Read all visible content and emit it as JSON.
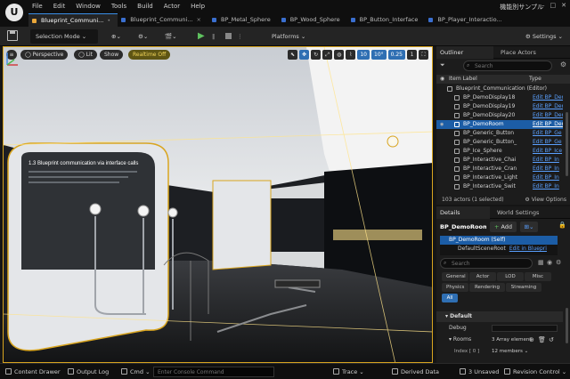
{
  "menu": [
    "File",
    "Edit",
    "Window",
    "Tools",
    "Build",
    "Actor",
    "Help"
  ],
  "project_name": "機能別サンプル",
  "tabs": [
    {
      "label": "Blueprint_Communi...",
      "active": true,
      "mark": "•"
    },
    {
      "label": "Blueprint_Communi...",
      "active": false,
      "mark": "×"
    },
    {
      "label": "BP_Metal_Sphere",
      "active": false,
      "mark": ""
    },
    {
      "label": "BP_Wood_Sphere",
      "active": false,
      "mark": ""
    },
    {
      "label": "BP_Button_Interface",
      "active": false,
      "mark": ""
    },
    {
      "label": "BP_Player_Interactio...",
      "active": false,
      "mark": ""
    }
  ],
  "toolbar": {
    "selection_mode": "Selection Mode ⌄",
    "platforms": "Platforms ⌄",
    "settings": "⚙ Settings ⌄"
  },
  "viewport": {
    "menu_icon": "≡",
    "perspective": "◯ Perspective",
    "lit": "◯ Lit",
    "show": "Show",
    "realtime": "Realtime Off",
    "grid_snap": "10",
    "rotation_snap": "10°",
    "scale_snap": "0.25",
    "camera_speed": "1",
    "wall_text": "1.3 Blueprint communication via interface calls",
    "colors": {
      "accent": "#d9a51f",
      "light": "#ffe38a"
    }
  },
  "outliner": {
    "tab_label": "Outliner",
    "place_actors_label": "Place Actors",
    "search_placeholder": "Search",
    "col_label": "Item Label",
    "col_type": "Type",
    "root": "Blueprint_Communication (Editor)",
    "rows": [
      {
        "label": "BP_DemoDisplay18",
        "type": "Edit BP_Dem",
        "selected": false
      },
      {
        "label": "BP_DemoDisplay19",
        "type": "Edit BP_Dem",
        "selected": false
      },
      {
        "label": "BP_DemoDisplay20",
        "type": "Edit BP_Dem",
        "selected": false
      },
      {
        "label": "BP_DemoRoom",
        "type": "Edit BP_Dem",
        "selected": true
      },
      {
        "label": "BP_Generic_Button",
        "type": "Edit BP_Ge",
        "selected": false
      },
      {
        "label": "BP_Generic_Button_",
        "type": "Edit BP_Ge",
        "selected": false
      },
      {
        "label": "BP_Ice_Sphere",
        "type": "Edit BP_Ice",
        "selected": false
      },
      {
        "label": "BP_Interactive_Chai",
        "type": "Edit BP_In",
        "selected": false
      },
      {
        "label": "BP_Interactive_Cran",
        "type": "Edit BP_In",
        "selected": false
      },
      {
        "label": "BP_Interactive_Light",
        "type": "Edit BP_In",
        "selected": false
      },
      {
        "label": "BP_Interactive_Swit",
        "type": "Edit BP_In",
        "selected": false
      }
    ],
    "actor_count": "103 actors (1 selected)",
    "view_options": "⚙ View Options"
  },
  "details": {
    "tab_label": "Details",
    "world_settings_label": "World Settings",
    "actor_name": "BP_DemoRoom",
    "add_label": "Add",
    "components": [
      {
        "label": "BP_DemoRoom (Self)",
        "link": "",
        "selected": true
      },
      {
        "label": "DefaultSceneRoot",
        "link": "Edit in Bluepri",
        "selected": false
      }
    ],
    "search_placeholder": "Search",
    "categories": [
      {
        "label": "General",
        "on": false
      },
      {
        "label": "Actor",
        "on": false
      },
      {
        "label": "LOD",
        "on": false
      },
      {
        "label": "Misc",
        "on": false
      },
      {
        "label": "Physics",
        "on": false
      },
      {
        "label": "Rendering",
        "on": false
      },
      {
        "label": "Streaming",
        "on": false
      },
      {
        "label": "All",
        "on": true
      }
    ],
    "section_default": "Default",
    "debug_label": "Debug",
    "rooms_label": "Rooms",
    "rooms_value": "3 Array element",
    "index_label": "Index [ 0 ]",
    "index_value": "12 members ⌄"
  },
  "statusbar": {
    "content_drawer": "Content Drawer",
    "output_log": "Output Log",
    "cmd": "Cmd ⌄",
    "console_placeholder": "Enter Console Command",
    "trace": "Trace ⌄",
    "derived_data": "Derived Data",
    "unsaved": "3 Unsaved",
    "revision_control": "Revision Control ⌄"
  }
}
